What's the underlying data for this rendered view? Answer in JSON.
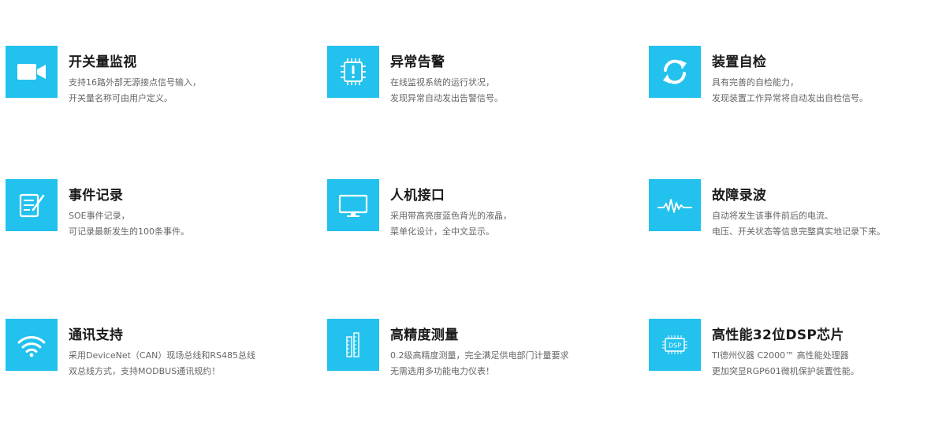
{
  "colors": {
    "accent": "#23c1ee",
    "title": "#1a1a1a",
    "text": "#666666"
  },
  "features": [
    {
      "icon": "video-camera-icon",
      "title": "开关量监视",
      "lines": [
        "支持16路外部无源接点信号输入，",
        "开关量名称可由用户定义。"
      ]
    },
    {
      "icon": "chip-alert-icon",
      "title": "异常告警",
      "lines": [
        "在线监视系统的运行状况，",
        "发现异常自动发出告警信号。"
      ]
    },
    {
      "icon": "refresh-icon",
      "title": "装置自检",
      "lines": [
        "具有完善的自检能力，",
        "发现装置工作异常将自动发出自检信号。"
      ]
    },
    {
      "icon": "event-record-icon",
      "title": "事件记录",
      "lines": [
        "SOE事件记录，",
        "可记录最新发生的100条事件。"
      ]
    },
    {
      "icon": "monitor-icon",
      "title": "人机接口",
      "lines": [
        "采用带高亮度蓝色背光的液晶，",
        "菜单化设计，全中文显示。"
      ]
    },
    {
      "icon": "waveform-icon",
      "title": "故障录波",
      "lines": [
        "自动将发生该事件前后的电流、",
        "电压、开关状态等信息完整真实地记录下来。"
      ]
    },
    {
      "icon": "wifi-icon",
      "title": "通讯支持",
      "lines": [
        "采用DeviceNet（CAN）现场总线和RS485总线",
        "双总线方式，支持MODBUS通讯规约！"
      ]
    },
    {
      "icon": "ruler-icon",
      "title": "高精度测量",
      "lines": [
        "0.2级高精度测量，完全满足供电部门计量要求",
        "无需选用多功能电力仪表！"
      ]
    },
    {
      "icon": "dsp-chip-icon",
      "title": "高性能32位DSP芯片",
      "lines": [
        "TI德州仪器 C2000™ 高性能处理器",
        "更加突显RGP601微机保护装置性能。"
      ],
      "icon_label": "DSP"
    }
  ]
}
